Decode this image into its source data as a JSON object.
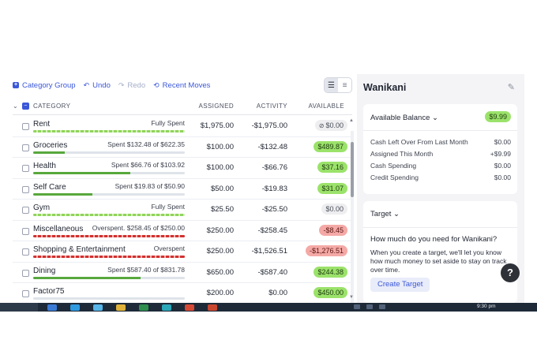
{
  "toolbar": {
    "category_group": "Category Group",
    "undo": "Undo",
    "redo": "Redo",
    "recent_moves": "Recent Moves"
  },
  "table": {
    "headers": {
      "category": "CATEGORY",
      "assigned": "ASSIGNED",
      "activity": "ACTIVITY",
      "available": "AVAILABLE"
    },
    "rows": [
      {
        "name": "Rent",
        "status": "Fully Spent",
        "progress": 1.0,
        "assigned": "$1,975.00",
        "activity": "-$1,975.00",
        "available": "$0.00",
        "available_style": "neutral-check"
      },
      {
        "name": "Groceries",
        "status": "Spent $132.48 of $622.35",
        "progress": 0.21,
        "assigned": "$100.00",
        "activity": "-$132.48",
        "available": "$489.87",
        "available_style": "green"
      },
      {
        "name": "Health",
        "status": "Spent $66.76 of $103.92",
        "progress": 0.64,
        "assigned": "$100.00",
        "activity": "-$66.76",
        "available": "$37.16",
        "available_style": "green"
      },
      {
        "name": "Self Care",
        "status": "Spent $19.83 of $50.90",
        "progress": 0.39,
        "assigned": "$50.00",
        "activity": "-$19.83",
        "available": "$31.07",
        "available_style": "green"
      },
      {
        "name": "Gym",
        "status": "Fully Spent",
        "progress": 1.0,
        "assigned": "$25.50",
        "activity": "-$25.50",
        "available": "$0.00",
        "available_style": "neutral"
      },
      {
        "name": "Miscellaneous",
        "status": "Overspent. $258.45 of $250.00",
        "progress": 1.0,
        "assigned": "$250.00",
        "activity": "-$258.45",
        "available": "-$8.45",
        "available_style": "red"
      },
      {
        "name": "Shopping & Entertainment",
        "status": "Overspent",
        "progress": 1.0,
        "assigned": "$250.00",
        "activity": "-$1,526.51",
        "available": "-$1,276.51",
        "available_style": "red"
      },
      {
        "name": "Dining",
        "status": "Spent $587.40 of $831.78",
        "progress": 0.71,
        "assigned": "$650.00",
        "activity": "-$587.40",
        "available": "$244.38",
        "available_style": "green"
      },
      {
        "name": "Factor75",
        "status": "",
        "progress": 0.0,
        "assigned": "$200.00",
        "activity": "$0.00",
        "available": "$450.00",
        "available_style": "green"
      }
    ]
  },
  "inspector": {
    "title": "Wanikani",
    "balance": {
      "label": "Available Balance",
      "value": "$9.99",
      "lines": [
        {
          "label": "Cash Left Over From Last Month",
          "value": "$0.00"
        },
        {
          "label": "Assigned This Month",
          "value": "+$9.99"
        },
        {
          "label": "Cash Spending",
          "value": "$0.00"
        },
        {
          "label": "Credit Spending",
          "value": "$0.00"
        }
      ]
    },
    "target": {
      "label": "Target",
      "question": "How much do you need for Wanikani?",
      "description": "When you create a target, we'll let you know how much money to set aside to stay on track over time.",
      "button": "Create Target"
    },
    "help": "?"
  },
  "taskbar": {
    "time": "9:30 pm"
  },
  "colors": {
    "accent": "#3a57d9",
    "green_pill": "#9be26a",
    "red_pill": "#f4a9a6",
    "progress_green": "#57a83c",
    "overspent_red": "#d2312f"
  }
}
